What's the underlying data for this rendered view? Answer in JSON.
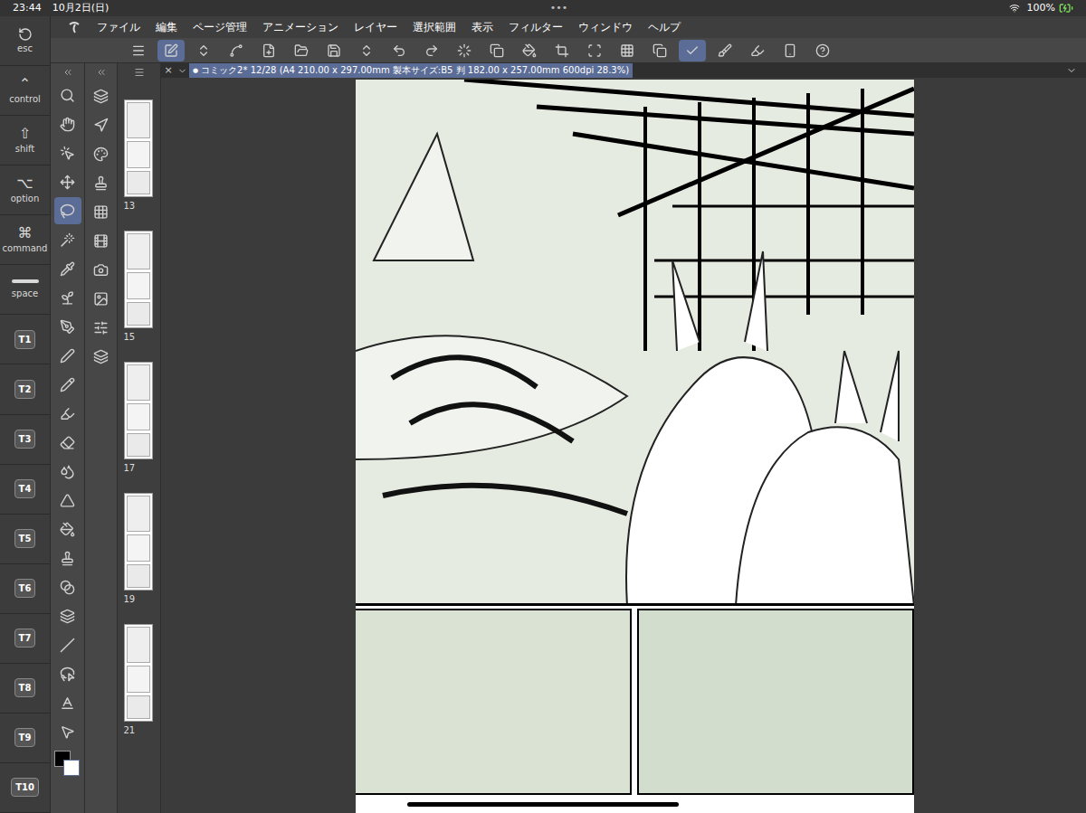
{
  "status_bar": {
    "time": "23:44",
    "date": "10月2日(日)",
    "dots": "•••",
    "battery": "100%"
  },
  "edge_keys": [
    {
      "label": "esc",
      "kind": "icon",
      "symbol": ""
    },
    {
      "label": "control",
      "kind": "glyph",
      "symbol": "⌃"
    },
    {
      "label": "shift",
      "kind": "glyph",
      "symbol": "⇧"
    },
    {
      "label": "option",
      "kind": "glyph",
      "symbol": "⌥"
    },
    {
      "label": "command",
      "kind": "glyph",
      "symbol": "⌘"
    },
    {
      "label": "space",
      "kind": "bar",
      "symbol": ""
    },
    {
      "label": "T1",
      "kind": "box",
      "symbol": ""
    },
    {
      "label": "T2",
      "kind": "box",
      "symbol": ""
    },
    {
      "label": "T3",
      "kind": "box",
      "symbol": ""
    },
    {
      "label": "T4",
      "kind": "box",
      "symbol": ""
    },
    {
      "label": "T5",
      "kind": "box",
      "symbol": ""
    },
    {
      "label": "T6",
      "kind": "box",
      "symbol": ""
    },
    {
      "label": "T7",
      "kind": "box",
      "symbol": ""
    },
    {
      "label": "T8",
      "kind": "box",
      "symbol": ""
    },
    {
      "label": "T9",
      "kind": "box",
      "symbol": ""
    },
    {
      "label": "T10",
      "kind": "box",
      "symbol": ""
    }
  ],
  "menu": [
    "ファイル",
    "編集",
    "ページ管理",
    "アニメーション",
    "レイヤー",
    "選択範囲",
    "表示",
    "フィルター",
    "ウィンドウ",
    "ヘルプ"
  ],
  "toolbar": [
    {
      "selected": false
    },
    {
      "selected": true
    },
    {
      "selected": false
    },
    {
      "selected": false
    },
    {
      "selected": false
    },
    {
      "selected": false
    },
    {
      "selected": false
    },
    {
      "selected": false
    },
    {
      "selected": false
    },
    {
      "selected": false
    },
    {
      "selected": false
    },
    {
      "selected": false
    },
    {
      "selected": false
    },
    {
      "selected": false
    },
    {
      "selected": false
    },
    {
      "selected": false
    },
    {
      "selected": false
    },
    {
      "selected": true
    },
    {
      "selected": false
    },
    {
      "selected": false
    },
    {
      "selected": false
    },
    {
      "selected": false
    }
  ],
  "tools": [
    {
      "selected": false
    },
    {
      "selected": false
    },
    {
      "selected": false
    },
    {
      "selected": false
    },
    {
      "selected": true
    },
    {
      "selected": false
    },
    {
      "selected": false
    },
    {
      "selected": false
    },
    {
      "selected": false
    },
    {
      "selected": false
    },
    {
      "selected": false
    },
    {
      "selected": false
    },
    {
      "selected": false
    },
    {
      "selected": false
    },
    {
      "selected": false
    },
    {
      "selected": false
    },
    {
      "selected": false
    },
    {
      "selected": false
    },
    {
      "selected": false
    },
    {
      "selected": false
    },
    {
      "selected": false
    },
    {
      "selected": false
    },
    {
      "selected": false
    }
  ],
  "document_tab": {
    "close": "×",
    "modified_dot": "●",
    "title": "コミック2* 12/28 (A4 210.00 x 297.00mm 製本サイズ:B5 判 182.00 x 257.00mm 600dpi 28.3%)"
  },
  "page_thumbnails": [
    {
      "number": "13"
    },
    {
      "number": "15"
    },
    {
      "number": "17"
    },
    {
      "number": "19"
    },
    {
      "number": "21"
    }
  ]
}
